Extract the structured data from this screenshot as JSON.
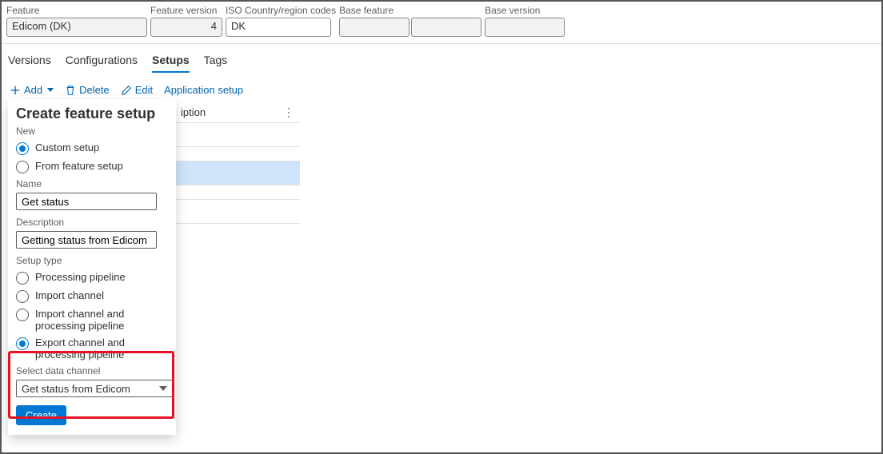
{
  "header": {
    "feature_label": "Feature",
    "feature_value": "Edicom (DK)",
    "version_label": "Feature version",
    "version_value": "4",
    "iso_label": "ISO Country/region codes",
    "iso_value": "DK",
    "base_feature_label": "Base feature",
    "base_feature_value": "",
    "base_version_label": "Base version",
    "base_version_value": ""
  },
  "tabs": {
    "versions": "Versions",
    "configurations": "Configurations",
    "setups": "Setups",
    "tags": "Tags"
  },
  "toolbar": {
    "add": "Add",
    "delete": "Delete",
    "edit": "Edit",
    "app_setup": "Application setup"
  },
  "table": {
    "col_description": "iption"
  },
  "dropdown": {
    "title": "Create feature setup",
    "new_label": "New",
    "opt_custom": "Custom setup",
    "opt_from_feature": "From feature setup",
    "name_label": "Name",
    "name_value": "Get status",
    "desc_label": "Description",
    "desc_value": "Getting status from Edicom",
    "setup_type_label": "Setup type",
    "opt_proc_pipe": "Processing pipeline",
    "opt_import": "Import channel",
    "opt_import_proc": "Import channel and processing pipeline",
    "opt_export_proc": "Export channel and processing pipeline",
    "select_ch_label": "Select data channel",
    "select_ch_value": "Get status from Edicom",
    "create_btn": "Create"
  }
}
